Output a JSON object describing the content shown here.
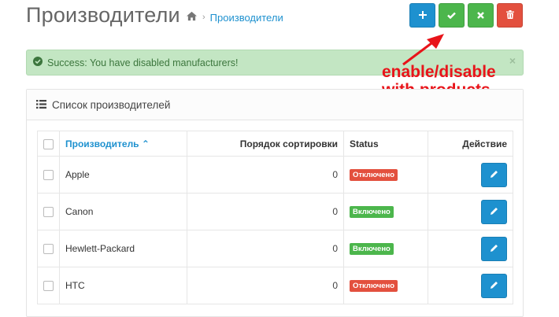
{
  "header": {
    "title": "Производители",
    "breadcrumb": [
      "Производители"
    ]
  },
  "toolbar": {
    "buttons": [
      {
        "name": "add",
        "icon": "plus-icon",
        "color": "#1e91cf"
      },
      {
        "name": "enable",
        "icon": "check-icon",
        "color": "#4cb64c"
      },
      {
        "name": "disable",
        "icon": "times-icon",
        "color": "#4cb64c"
      },
      {
        "name": "delete",
        "icon": "trash-icon",
        "color": "#e3503e"
      }
    ]
  },
  "alert": {
    "message": "Success: You have disabled manufacturers!",
    "close": "×"
  },
  "annotation": {
    "line1": "enable/disable",
    "line2": "with products",
    "color": "#e8141a"
  },
  "panel": {
    "title": "Список производителей"
  },
  "table": {
    "columns": {
      "name": "Производитель",
      "sort_order": "Порядок сортировки",
      "status": "Status",
      "action": "Действие"
    },
    "rows": [
      {
        "name": "Apple",
        "sort_order": "0",
        "status": "Отключено",
        "enabled": false
      },
      {
        "name": "Canon",
        "sort_order": "0",
        "status": "Включено",
        "enabled": true
      },
      {
        "name": "Hewlett-Packard",
        "sort_order": "0",
        "status": "Включено",
        "enabled": true
      },
      {
        "name": "HTC",
        "sort_order": "0",
        "status": "Отключено",
        "enabled": false
      }
    ]
  },
  "colors": {
    "primary": "#1e91cf",
    "success": "#4cb64c",
    "danger": "#e3503e",
    "alert_bg": "#c3e6c3"
  }
}
